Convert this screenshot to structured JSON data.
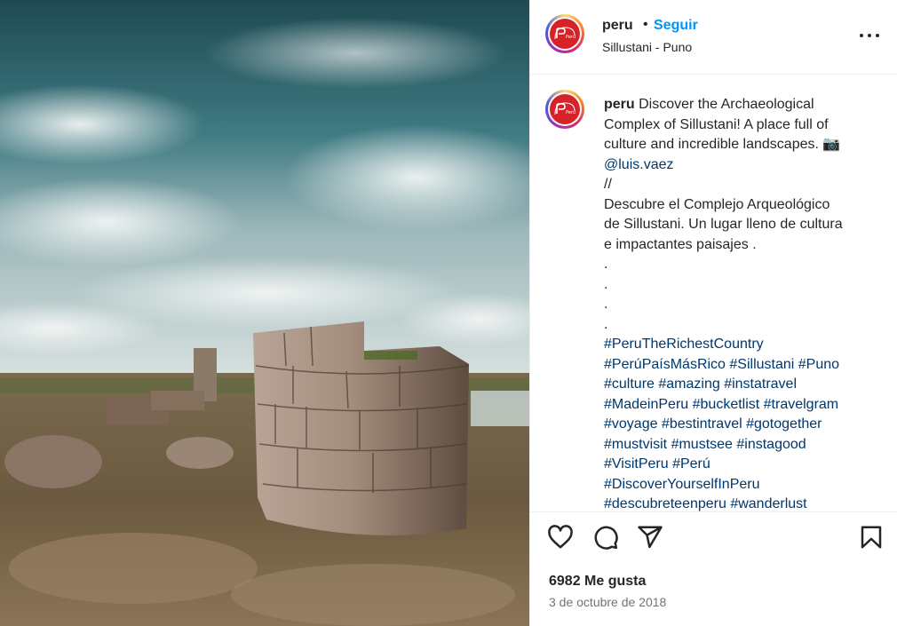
{
  "header": {
    "username": "peru",
    "separator": "•",
    "follow_label": "Seguir",
    "location": "Sillustani - Puno",
    "more_icon": "more-options-icon"
  },
  "caption": {
    "username": "peru",
    "lines": [
      "Discover the Archaeological",
      "Complex of Sillustani! A place full of",
      "culture and incredible landscapes. 📷",
      "@luis.vaez",
      "//",
      "Descubre el Complejo Arqueológico",
      "de Sillustani. Un lugar lleno de cultura",
      "e impactantes paisajes .",
      ".",
      ".",
      ".",
      ".",
      "#PeruTheRichestCountry",
      "#PerúPaísMásRico #Sillustani #Puno",
      "#culture #amazing #instatravel",
      "#MadeinPeru #bucketlist #travelgram",
      "#voyage #bestintravel #gotogether",
      "#mustvisit #mustsee #instagood",
      "#VisitPeru #Perú",
      "#DiscoverYourselfInPeru",
      "#descubreteenperu #wanderlust"
    ]
  },
  "actions": {
    "like_icon": "heart-icon",
    "comment_icon": "comment-icon",
    "share_icon": "share-icon",
    "save_icon": "bookmark-icon"
  },
  "stats": {
    "likes": "6982 Me gusta",
    "date": "3 de octubre de 2018"
  },
  "colors": {
    "link": "#0095f6",
    "hashtag": "#00376b",
    "brand": "#d6232a"
  }
}
